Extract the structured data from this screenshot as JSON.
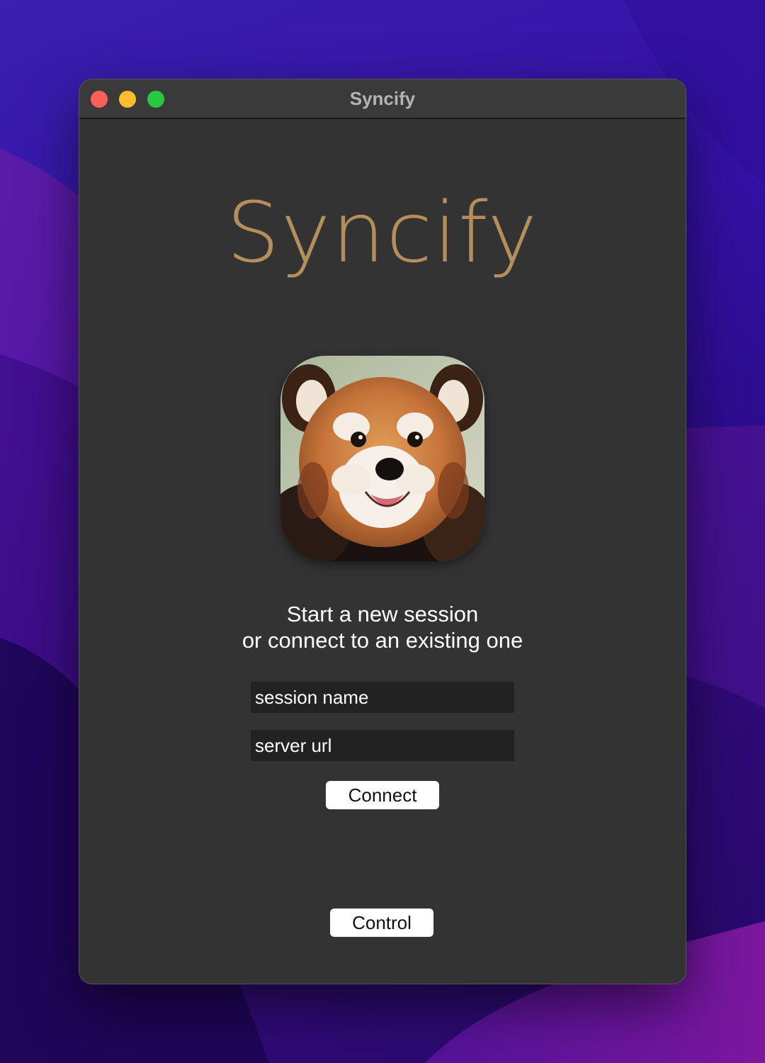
{
  "window": {
    "title": "Syncify"
  },
  "main": {
    "brand_title": "Syncify",
    "app_icon": "red-panda-app-icon",
    "prompt_line1": "Start a new session",
    "prompt_line2": "or connect to an existing one",
    "session_field": {
      "placeholder": "session name",
      "value": ""
    },
    "server_field": {
      "placeholder": "server url",
      "value": ""
    },
    "connect_label": "Connect",
    "control_label": "Control"
  },
  "colors": {
    "brand_gold": "#b58e5c",
    "window_bg": "#333333",
    "field_bg": "#222222",
    "close": "#fe5f57",
    "minimize": "#febc2e",
    "maximize": "#28c840"
  }
}
